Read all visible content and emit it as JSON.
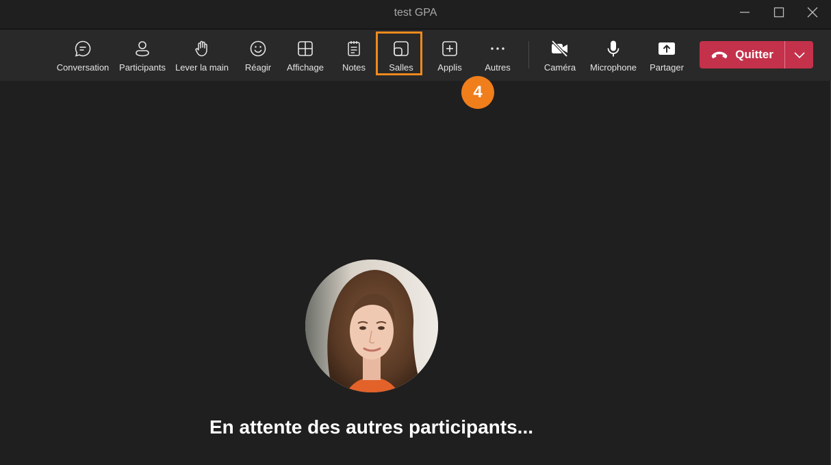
{
  "window": {
    "title": "test GPA"
  },
  "toolbar": {
    "items": [
      {
        "label": "Conversation",
        "icon": "chat-bubble-icon"
      },
      {
        "label": "Participants",
        "icon": "people-icon"
      },
      {
        "label": "Lever la main",
        "icon": "raise-hand-icon"
      },
      {
        "label": "Réagir",
        "icon": "smiley-icon"
      },
      {
        "label": "Affichage",
        "icon": "grid-view-icon"
      },
      {
        "label": "Notes",
        "icon": "notepad-icon"
      },
      {
        "label": "Salles",
        "icon": "breakout-rooms-icon"
      },
      {
        "label": "Applis",
        "icon": "add-app-icon"
      },
      {
        "label": "Autres",
        "icon": "more-dots-icon"
      },
      {
        "label": "Caméra",
        "icon": "camera-off-icon"
      },
      {
        "label": "Microphone",
        "icon": "microphone-icon"
      },
      {
        "label": "Partager",
        "icon": "share-screen-icon"
      }
    ],
    "leave_label": "Quitter"
  },
  "annotation": {
    "step_number": "4",
    "highlight_color": "#f28a1e",
    "badge_color": "#f07e1b"
  },
  "stage": {
    "waiting_text": "En attente des autres participants..."
  },
  "colors": {
    "leave_button": "#c4314b",
    "background": "#201f1f",
    "toolbar": "#292929"
  }
}
